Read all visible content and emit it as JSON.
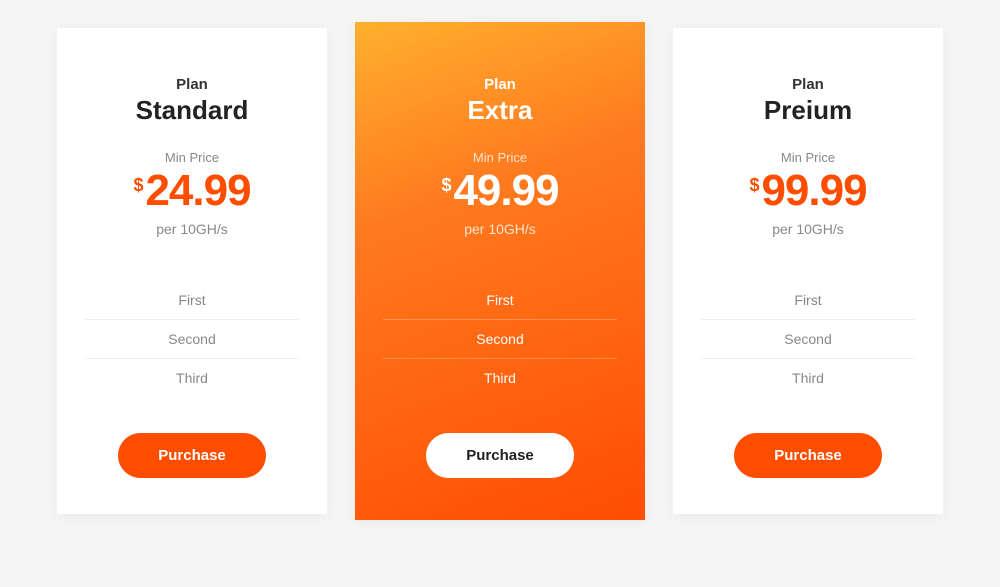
{
  "plans": [
    {
      "label": "Plan",
      "name": "Standard",
      "minPriceLabel": "Min Price",
      "currency": "$",
      "price": "24.99",
      "perUnit": "per 10GH/s",
      "features": [
        "First",
        "Second",
        "Third"
      ],
      "button": "Purchase"
    },
    {
      "label": "Plan",
      "name": "Extra",
      "minPriceLabel": "Min Price",
      "currency": "$",
      "price": "49.99",
      "perUnit": "per 10GH/s",
      "features": [
        "First",
        "Second",
        "Third"
      ],
      "button": "Purchase"
    },
    {
      "label": "Plan",
      "name": "Preium",
      "minPriceLabel": "Min Price",
      "currency": "$",
      "price": "99.99",
      "perUnit": "per 10GH/s",
      "features": [
        "First",
        "Second",
        "Third"
      ],
      "button": "Purchase"
    }
  ]
}
